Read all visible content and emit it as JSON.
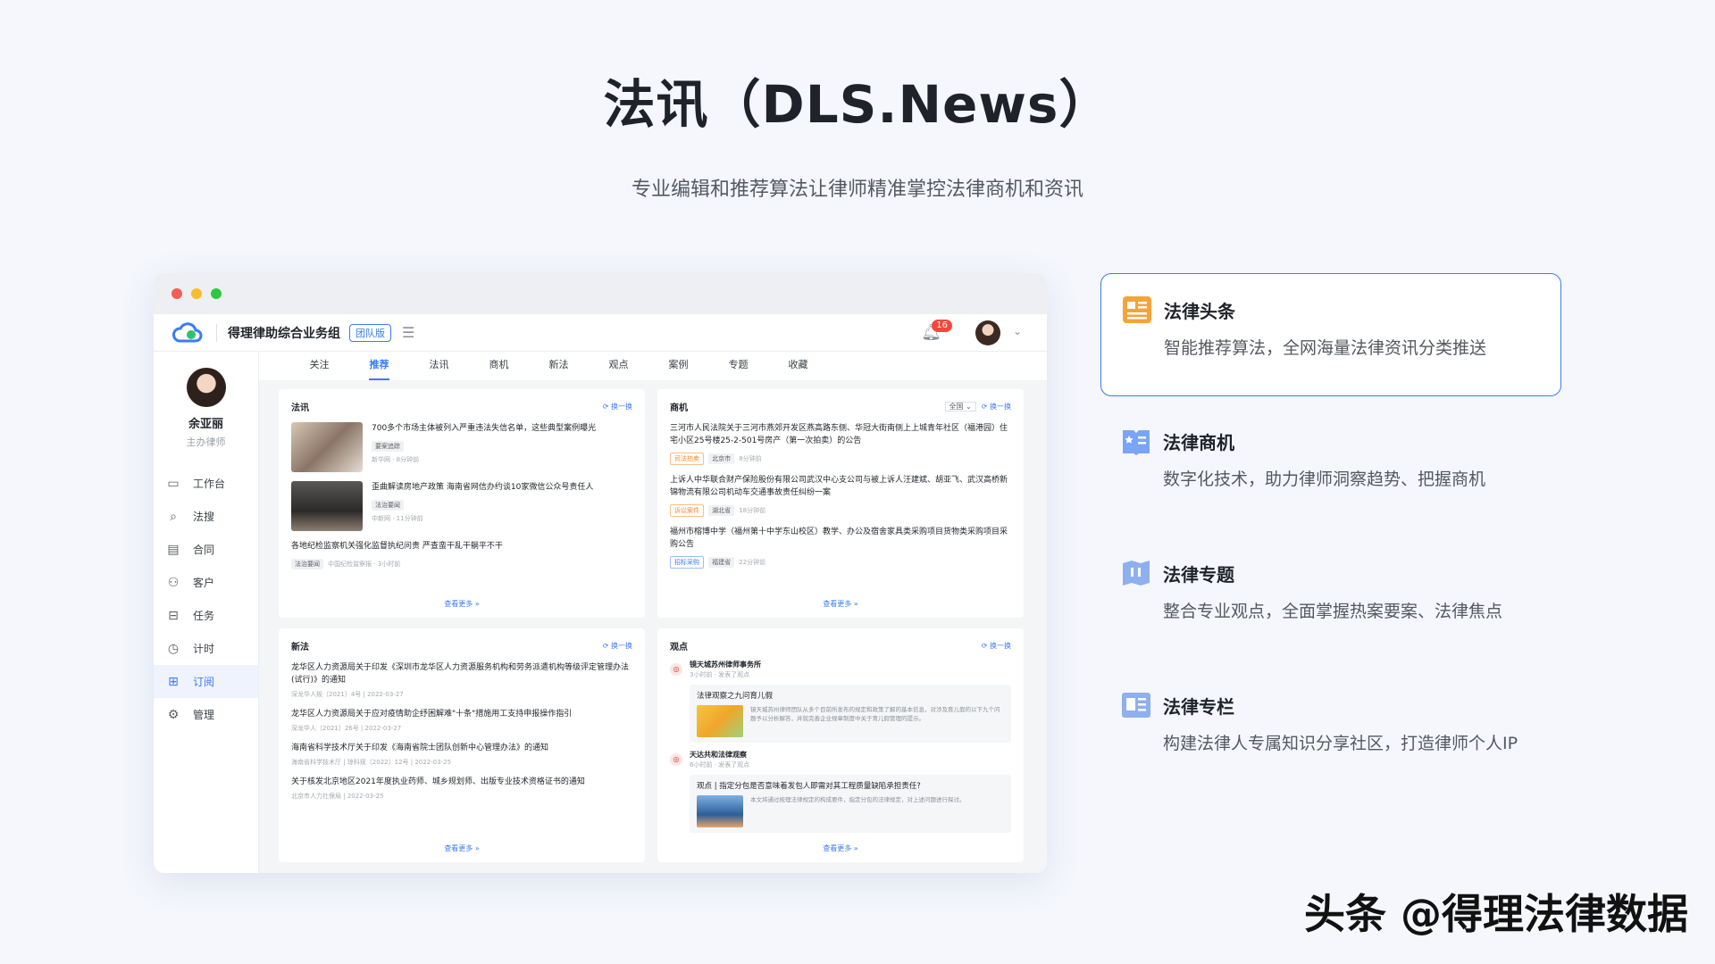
{
  "hero": {
    "title": "法讯（DLS.News）",
    "subtitle": "专业编辑和推荐算法让律师精准掌控法律商机和资讯"
  },
  "app": {
    "name": "得理律助综合业务组",
    "edition": "团队版",
    "notifications": "16"
  },
  "user": {
    "name": "余亚丽",
    "role": "主办律师"
  },
  "nav": [
    {
      "label": "工作台",
      "icon": "monitor-icon"
    },
    {
      "label": "法搜",
      "icon": "search-icon"
    },
    {
      "label": "合同",
      "icon": "document-icon"
    },
    {
      "label": "客户",
      "icon": "users-icon"
    },
    {
      "label": "任务",
      "icon": "briefcase-icon"
    },
    {
      "label": "计时",
      "icon": "clock-icon"
    },
    {
      "label": "订阅",
      "icon": "bookmark-icon"
    },
    {
      "label": "管理",
      "icon": "user-settings-icon"
    }
  ],
  "tabs": [
    "关注",
    "推荐",
    "法讯",
    "商机",
    "新法",
    "观点",
    "案例",
    "专题",
    "收藏"
  ],
  "labels": {
    "refresh": "换一换",
    "more": "查看更多 »",
    "filter": "全国"
  },
  "faxun": {
    "title": "法讯",
    "items": [
      {
        "title": "700多个市场主体被列入严重违法失信名单，这些典型案例曝光",
        "tag": "要案追踪",
        "meta": "新华网 · 8分钟前"
      },
      {
        "title": "歪曲解读房地产政策 海南省网信办约谈10家微信公众号责任人",
        "tag": "法治要闻",
        "meta": "中新网 · 11分钟前"
      },
      {
        "title": "各地纪检监察机关强化监督执纪问责 严查蛮干乱干躺平不干",
        "tag": "法治要闻",
        "meta": "中国纪检监察报 · 3小时前"
      }
    ]
  },
  "shangji": {
    "title": "商机",
    "items": [
      {
        "title": "三河市人民法院关于三河市燕郊开发区燕高路东侧、华冠大街南侧上上城青年社区（福港园）住宅小区25号楼25-2-501号房产（第一次拍卖）的公告",
        "tag": "司法拍卖",
        "tag2": "北京市",
        "meta": "8分钟前"
      },
      {
        "title": "上诉人中华联合财产保险股份有限公司武汉中心支公司与被上诉人汪建斌、胡亚飞、武汉高桥新锦物流有限公司机动车交通事故责任纠纷一案",
        "tag": "诉讼案件",
        "tag2": "湖北省",
        "meta": "18分钟前"
      },
      {
        "title": "福州市榕博中学（福州第十中学东山校区）教学、办公及宿舍家具类采购项目货物类采购项目采购公告",
        "tag": "招标采购",
        "tag2": "福建省",
        "meta": "22分钟前"
      }
    ]
  },
  "xinfa": {
    "title": "新法",
    "items": [
      {
        "title": "龙华区人力资源局关于印发《深圳市龙华区人力资源服务机构和劳务派遣机构等级评定管理办法(试行)》的通知",
        "meta": "深龙华人规〔2021〕4号 | 2022-03-27"
      },
      {
        "title": "龙华区人力资源局关于应对疫情助企纾困解难\"十条\"措施用工支持申报操作指引",
        "meta": "深龙华人〔2021〕26号 | 2022-03-27"
      },
      {
        "title": "海南省科学技术厅关于印发《海南省院士团队创新中心管理办法》的通知",
        "meta": "海南省科学技术厅 | 琼科规〔2022〕12号 | 2022-03-25"
      },
      {
        "title": "关于核发北京地区2021年度执业药师、城乡规划师、出版专业技术资格证书的通知",
        "meta": "北京市人力社保局 | 2022-03-25"
      }
    ]
  },
  "guandian": {
    "title": "观点",
    "items": [
      {
        "source": "镜天城苏州律师事务所",
        "time": "3小时前 · 发表了观点",
        "title": "法律观察之九问育儿假",
        "text": "镜天城苏州律师团队从多个目前所发布的规定和政策了解的基本信息，对涉及育儿假的以下九个问题予以分析解答，并就完善企业规章制度中关于育儿假管理的提示。"
      },
      {
        "source": "天达共和法律观察",
        "time": "6小时前 · 发表了观点",
        "title": "观点 | 指定分包是否意味着发包人即需对其工程质量缺陷承担责任?",
        "text": "本文将通过梳理法律规定的构成要件，指定分包的法律规定，对上述问题进行探讨。"
      }
    ]
  },
  "features": [
    {
      "title": "法律头条",
      "desc": "智能推荐算法，全网海量法律资讯分类推送",
      "icon": "headline-icon"
    },
    {
      "title": "法律商机",
      "desc": "数字化技术，助力律师洞察趋势、把握商机",
      "icon": "opportunity-icon"
    },
    {
      "title": "法律专题",
      "desc": "整合专业观点，全面掌握热案要案、法律焦点",
      "icon": "topic-icon"
    },
    {
      "title": "法律专栏",
      "desc": "构建法律人专属知识分享社区，打造律师个人IP",
      "icon": "column-icon"
    }
  ],
  "watermark": "头条 @得理法律数据",
  "colors": {
    "accent": "#3a7bf7",
    "orange": "#f5a33b",
    "red": "#f5483b"
  }
}
